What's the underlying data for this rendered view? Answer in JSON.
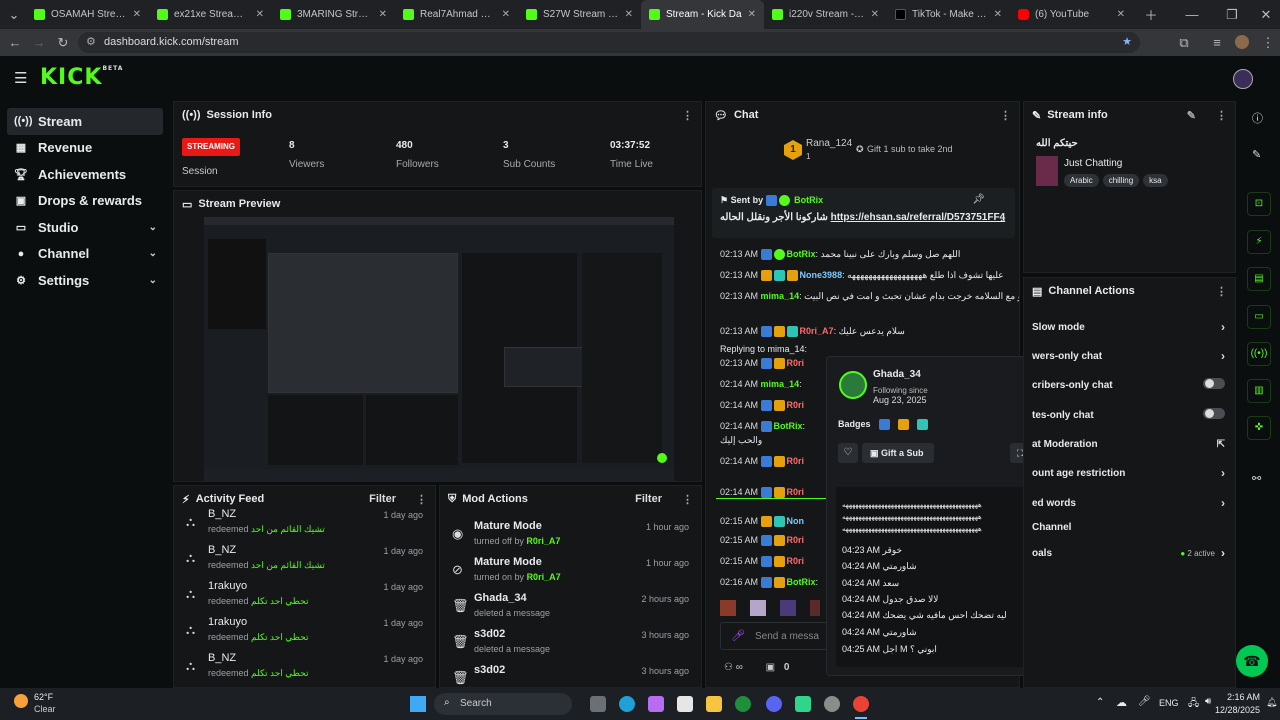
{
  "browser": {
    "tabs": [
      {
        "title": "OSAMAH Stream - W",
        "icon": "kick-icon"
      },
      {
        "title": "ex21xe Stream - Wat",
        "icon": "kick-icon"
      },
      {
        "title": "3MARING Stream - W",
        "icon": "kick-icon"
      },
      {
        "title": "Real7Ahmad Stream",
        "icon": "kick-icon"
      },
      {
        "title": "S27W Stream - Watc",
        "icon": "kick-icon"
      },
      {
        "title": "Stream - Kick Da",
        "icon": "kick-icon"
      },
      {
        "title": "i220v Stream - Watc",
        "icon": "kick-icon"
      },
      {
        "title": "TikTok - Make Your D",
        "icon": "tiktok-icon"
      },
      {
        "title": "(6) YouTube",
        "icon": "youtube-icon"
      }
    ],
    "url": "dashboard.kick.com/stream"
  },
  "brand": {
    "logo": "KICK",
    "beta": "BETA"
  },
  "sidebar": {
    "items": [
      {
        "label": "Stream",
        "icon": "stream-icon",
        "active": true
      },
      {
        "label": "Revenue",
        "icon": "revenue-icon"
      },
      {
        "label": "Achievements",
        "icon": "trophy-icon"
      },
      {
        "label": "Drops & rewards",
        "icon": "gift-icon"
      },
      {
        "label": "Studio",
        "icon": "studio-icon",
        "expandable": true
      },
      {
        "label": "Channel",
        "icon": "user-icon",
        "expandable": true
      },
      {
        "label": "Settings",
        "icon": "gear-icon",
        "expandable": true
      }
    ]
  },
  "session": {
    "title": "Session Info",
    "status": "STREAMING",
    "status_label": "Session",
    "stats": [
      {
        "value": "8",
        "label": "Viewers"
      },
      {
        "value": "480",
        "label": "Followers"
      },
      {
        "value": "3",
        "label": "Sub Counts"
      },
      {
        "value": "03:37:52",
        "label": "Time Live"
      }
    ]
  },
  "preview": {
    "title": "Stream Preview"
  },
  "activity": {
    "title": "Activity Feed",
    "filter": "Filter",
    "items": [
      {
        "name": "B_NZ",
        "action": "redeemed",
        "reward": "تشيك القائم من احد",
        "time": "1 day ago"
      },
      {
        "name": "B_NZ",
        "action": "redeemed",
        "reward": "تشيك القائم من احد",
        "time": "1 day ago"
      },
      {
        "name": "1rakuyo",
        "action": "redeemed",
        "reward": "تحطي احد تكلم",
        "time": "1 day ago"
      },
      {
        "name": "1rakuyo",
        "action": "redeemed",
        "reward": "تحطي احد تكلم",
        "time": "1 day ago"
      },
      {
        "name": "B_NZ",
        "action": "redeemed",
        "reward": "تحطي احد تكلم",
        "time": "1 day ago"
      }
    ]
  },
  "mod_actions": {
    "title": "Mod Actions",
    "filter": "Filter",
    "items": [
      {
        "title": "Mature Mode",
        "desc": "turned off by",
        "by": "R0ri_A7",
        "time": "1 hour ago",
        "icon": "eye-icon"
      },
      {
        "title": "Mature Mode",
        "desc": "turned on by",
        "by": "R0ri_A7",
        "time": "1 hour ago",
        "icon": "eye-off-icon"
      },
      {
        "title": "Ghada_34",
        "desc": "deleted a message",
        "by": "",
        "time": "2 hours ago",
        "icon": "trash-icon"
      },
      {
        "title": "s3d02",
        "desc": "deleted a message",
        "by": "",
        "time": "3 hours ago",
        "icon": "trash-icon"
      },
      {
        "title": "s3d02",
        "desc": "",
        "by": "",
        "time": "3 hours ago",
        "icon": "trash-icon"
      }
    ]
  },
  "chat": {
    "title": "Chat",
    "top_gifter": {
      "rank": "1",
      "name": "Rana_124",
      "count": "1",
      "hint": "Gift 1 sub to take 2nd"
    },
    "pinned": {
      "sent_by_label": "Sent by",
      "user": "BotRix",
      "text": "شاركونا الأجر ونقلل الحاله",
      "link": "https://ehsan.sa/referral/D573751FF4"
    },
    "messages": [
      {
        "time": "02:13 AM",
        "user": "BotRix",
        "text": "اللهم صل وسلم وبارك على نبينا محمد",
        "color": "g"
      },
      {
        "time": "02:13 AM",
        "user": "None3988",
        "text": "عليها تشوف اذا طلع ههههههههههههههههههه",
        "color": "c"
      },
      {
        "time": "02:13 AM",
        "user": "mima_14",
        "text": "داخه تقول القول الو مع السلامه خرجت بدام عشان تحبث و امت في نص البيت",
        "color": "g"
      },
      {
        "time": "02:13 AM",
        "user": "R0ri_A7",
        "text": "سلام يدعس عليك",
        "color": "p"
      },
      {
        "time": "02:13 AM",
        "user": "R0ri",
        "text": "",
        "color": "p"
      },
      {
        "time": "02:14 AM",
        "user": "mima_14",
        "text": "",
        "color": "g"
      },
      {
        "time": "02:14 AM",
        "user": "R0ri",
        "text": "",
        "color": "p"
      },
      {
        "time": "02:14 AM",
        "user": "BotRix",
        "text": "",
        "color": "g"
      },
      {
        "time": "02:14 AM",
        "user": "R0ri",
        "text": "",
        "color": "p"
      },
      {
        "time": "02:14 AM",
        "user": "R0ri",
        "text": "",
        "color": "p"
      },
      {
        "time": "02:15 AM",
        "user": "Non",
        "text": "",
        "color": "c"
      },
      {
        "time": "02:15 AM",
        "user": "R0ri",
        "text": "",
        "color": "p"
      },
      {
        "time": "02:15 AM",
        "user": "R0ri",
        "text": "",
        "color": "p"
      },
      {
        "time": "02:16 AM",
        "user": "BotRix",
        "text": "",
        "color": "g"
      }
    ],
    "reply_hint": "Replying to mima_14:",
    "reply_extra": "والحب إليك",
    "input_placeholder": "Send a messa",
    "points": "0"
  },
  "user_card": {
    "name": "Ghada_34",
    "following_label": "Following since",
    "following_date": "Aug 23, 2025",
    "badges_label": "Badges",
    "gift_label": "Gift a Sub",
    "history": [
      {
        "time": "",
        "text": "ههههههههههههههههههههههههههههههههههههههههههه"
      },
      {
        "time": "",
        "text": "ههههههههههههههههههههههههههههههههههههههههههه"
      },
      {
        "time": "",
        "text": "ههههههههههههههههههههههههههههههههههههههههههه"
      },
      {
        "time": "04:23 AM",
        "text": "خوقر"
      },
      {
        "time": "04:24 AM",
        "text": "شاورمتي"
      },
      {
        "time": "04:24 AM",
        "text": "سعد"
      },
      {
        "time": "04:24 AM",
        "text": "لالا صدق جدول"
      },
      {
        "time": "04:24 AM",
        "text": "ليه تضحك احس مافيه شي يضحك"
      },
      {
        "time": "04:24 AM",
        "text": "شاورمتي"
      },
      {
        "time": "04:25 AM",
        "text": "اجل M ابوني ؟"
      }
    ]
  },
  "stream_info": {
    "title": "Stream info",
    "stream_title": "حيتكم الله",
    "category": "Just Chatting",
    "tags": [
      "Arabic",
      "chilling",
      "ksa"
    ]
  },
  "channel_actions": {
    "title": "Channel Actions",
    "items": [
      {
        "label": "Slow mode",
        "control": "chevron"
      },
      {
        "label": "wers-only chat",
        "control": "chevron"
      },
      {
        "label": "cribers-only chat",
        "control": "toggle"
      },
      {
        "label": "tes-only chat",
        "control": "toggle"
      },
      {
        "label": "at Moderation",
        "control": "external"
      },
      {
        "label": "ount age restriction",
        "control": "chevron"
      },
      {
        "label": "ed words",
        "control": "chevron"
      },
      {
        "label": "Channel",
        "control": "none"
      },
      {
        "label": "oals",
        "control": "chevron",
        "status": "2 active"
      }
    ]
  },
  "taskbar": {
    "weather_temp": "62°F",
    "weather_desc": "Clear",
    "search": "Search",
    "lang": "ENG",
    "time": "2:16 AM",
    "date": "12/28/2025"
  },
  "colors": {
    "accent": "#53fc18",
    "streaming": "#e91916"
  }
}
